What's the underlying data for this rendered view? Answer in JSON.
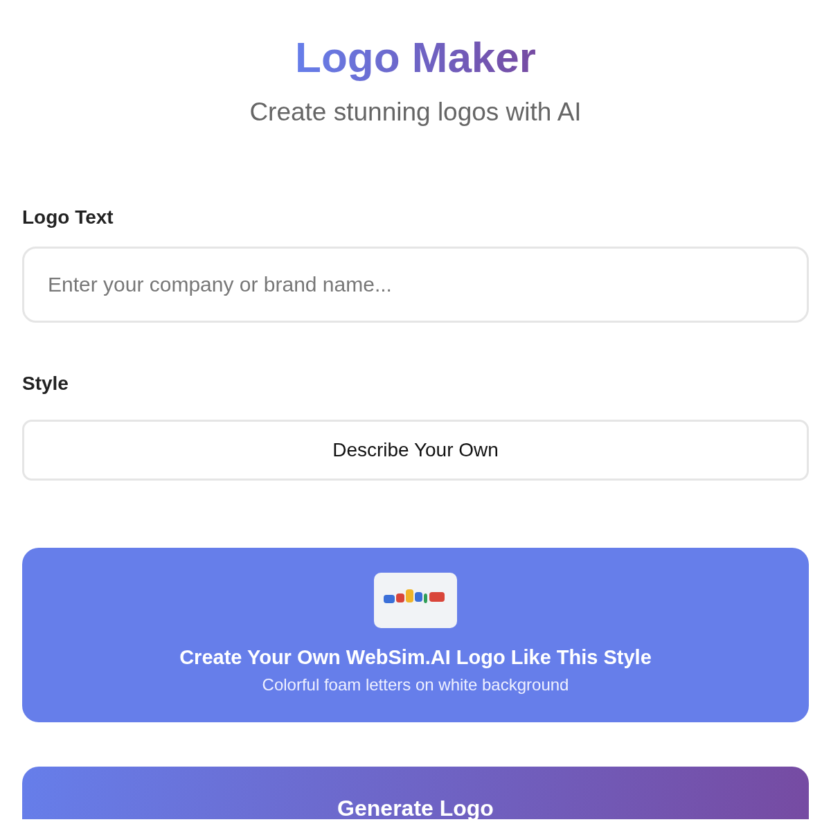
{
  "header": {
    "title": "Logo Maker",
    "subtitle": "Create stunning logos with AI"
  },
  "logo_text": {
    "label": "Logo Text",
    "placeholder": "Enter your company or brand name..."
  },
  "style": {
    "label": "Style",
    "value": "Describe Your Own"
  },
  "preset_card": {
    "title": "Create Your Own WebSim.AI Logo Like This Style",
    "description": "Colorful foam letters on white background"
  },
  "generate_button": {
    "label": "Generate Logo"
  }
}
